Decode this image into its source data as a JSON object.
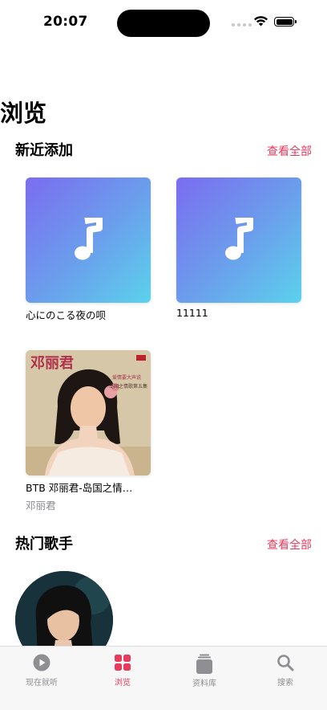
{
  "status_bar": {
    "time": "20:07"
  },
  "page": {
    "title": "浏览"
  },
  "recently_added": {
    "title": "新近添加",
    "see_all": "查看全部",
    "albums": [
      {
        "title": "心にのこる夜の呗",
        "artist": ""
      },
      {
        "title": "11111",
        "artist": ""
      },
      {
        "title": "BTB 邓丽君-岛国之情…",
        "artist": "邓丽君"
      }
    ]
  },
  "hot_artists": {
    "title": "热门歌手",
    "see_all": "查看全部"
  },
  "tab_bar": {
    "tabs": [
      {
        "label": "现在就听",
        "icon": "play-circle-icon",
        "active": false
      },
      {
        "label": "浏览",
        "icon": "grid-icon",
        "active": true
      },
      {
        "label": "资料库",
        "icon": "library-stack-icon",
        "active": false
      },
      {
        "label": "搜索",
        "icon": "search-icon",
        "active": false
      }
    ]
  },
  "colors": {
    "accent": "#e83a5c",
    "gradient_start": "#7b6cf0",
    "gradient_end": "#5bd2ec",
    "secondary_text": "#8a8a8e"
  }
}
